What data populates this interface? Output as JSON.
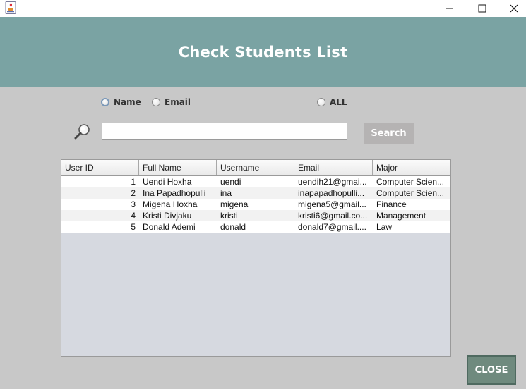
{
  "window": {
    "minimize_label": "─",
    "maximize_label": "☐",
    "close_label": "✕"
  },
  "header": {
    "title": "Check Students List"
  },
  "filters": {
    "name_label": "Name",
    "email_label": "Email",
    "all_label": "ALL",
    "selected": "Name"
  },
  "search": {
    "value": "",
    "placeholder": "",
    "button_label": "Search"
  },
  "table": {
    "columns": [
      "User ID",
      "Full Name",
      "Username",
      "Email",
      "Major"
    ],
    "rows": [
      [
        "1",
        "Uendi Hoxha",
        "uendi",
        "uendih21@gmai...",
        "Computer Scien..."
      ],
      [
        "2",
        "Ina Papadhopulli",
        "ina",
        "inapapadhopulli...",
        "Computer Scien..."
      ],
      [
        "3",
        "Migena Hoxha",
        "migena",
        "migena5@gmail...",
        "Finance"
      ],
      [
        "4",
        "Kristi Divjaku",
        "kristi",
        "kristi6@gmail.co...",
        "Management"
      ],
      [
        "5",
        "Donald Ademi",
        "donald",
        "donald7@gmail....",
        "Law"
      ]
    ]
  },
  "footer": {
    "close_label": "CLOSE"
  },
  "colors": {
    "header_bg": "#7aa3a3",
    "background": "#c8c8c8",
    "table_empty_bg": "#d6d9e0",
    "search_button_bg": "#b5b3b3",
    "close_button_bg": "#6f8a7e"
  },
  "icons": {
    "app": "java-coffee-cup-icon",
    "search": "magnifier-icon"
  }
}
